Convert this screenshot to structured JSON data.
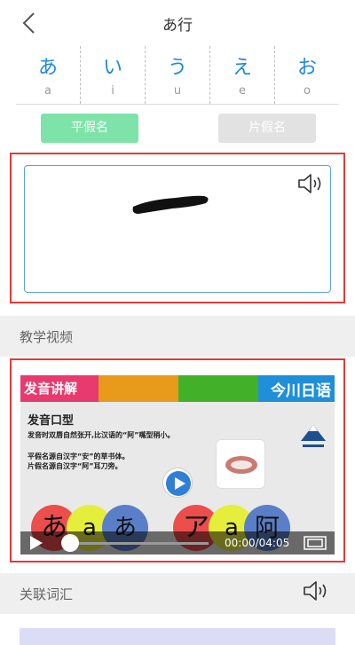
{
  "header": {
    "title": "あ行"
  },
  "kana_tabs": [
    {
      "kana": "あ",
      "romaji": "a"
    },
    {
      "kana": "い",
      "romaji": "i"
    },
    {
      "kana": "う",
      "romaji": "u"
    },
    {
      "kana": "え",
      "romaji": "e"
    },
    {
      "kana": "お",
      "romaji": "o"
    }
  ],
  "script_toggle": {
    "hiragana_label": "平假名",
    "katakana_label": "片假名",
    "selected": "hiragana"
  },
  "sections": {
    "video_title": "教学视频",
    "vocab_title": "关联词汇"
  },
  "video": {
    "banner_title": "发音讲解",
    "brand": "今川日语",
    "subtitle": "发音口型",
    "lines": [
      "发音时双唇自然张开,比汉语的“阿”嘴型稍小。",
      "平假名源自汉字“安”的草书体。",
      "片假名源自汉字“阿”耳刀旁。"
    ],
    "bubbles": [
      "あ",
      "a",
      "あ",
      "ア",
      "a",
      "阿"
    ],
    "time": "00:00/04:05",
    "progress": 0,
    "banner_colors": [
      "#e83a6e",
      "#f2b233",
      "#e89a1a",
      "#43b02a",
      "#1e8fd8"
    ]
  },
  "colors": {
    "accent": "#1e88e5",
    "highlight_frame": "#e53935",
    "hiragana_active": "#7ee3a8"
  }
}
